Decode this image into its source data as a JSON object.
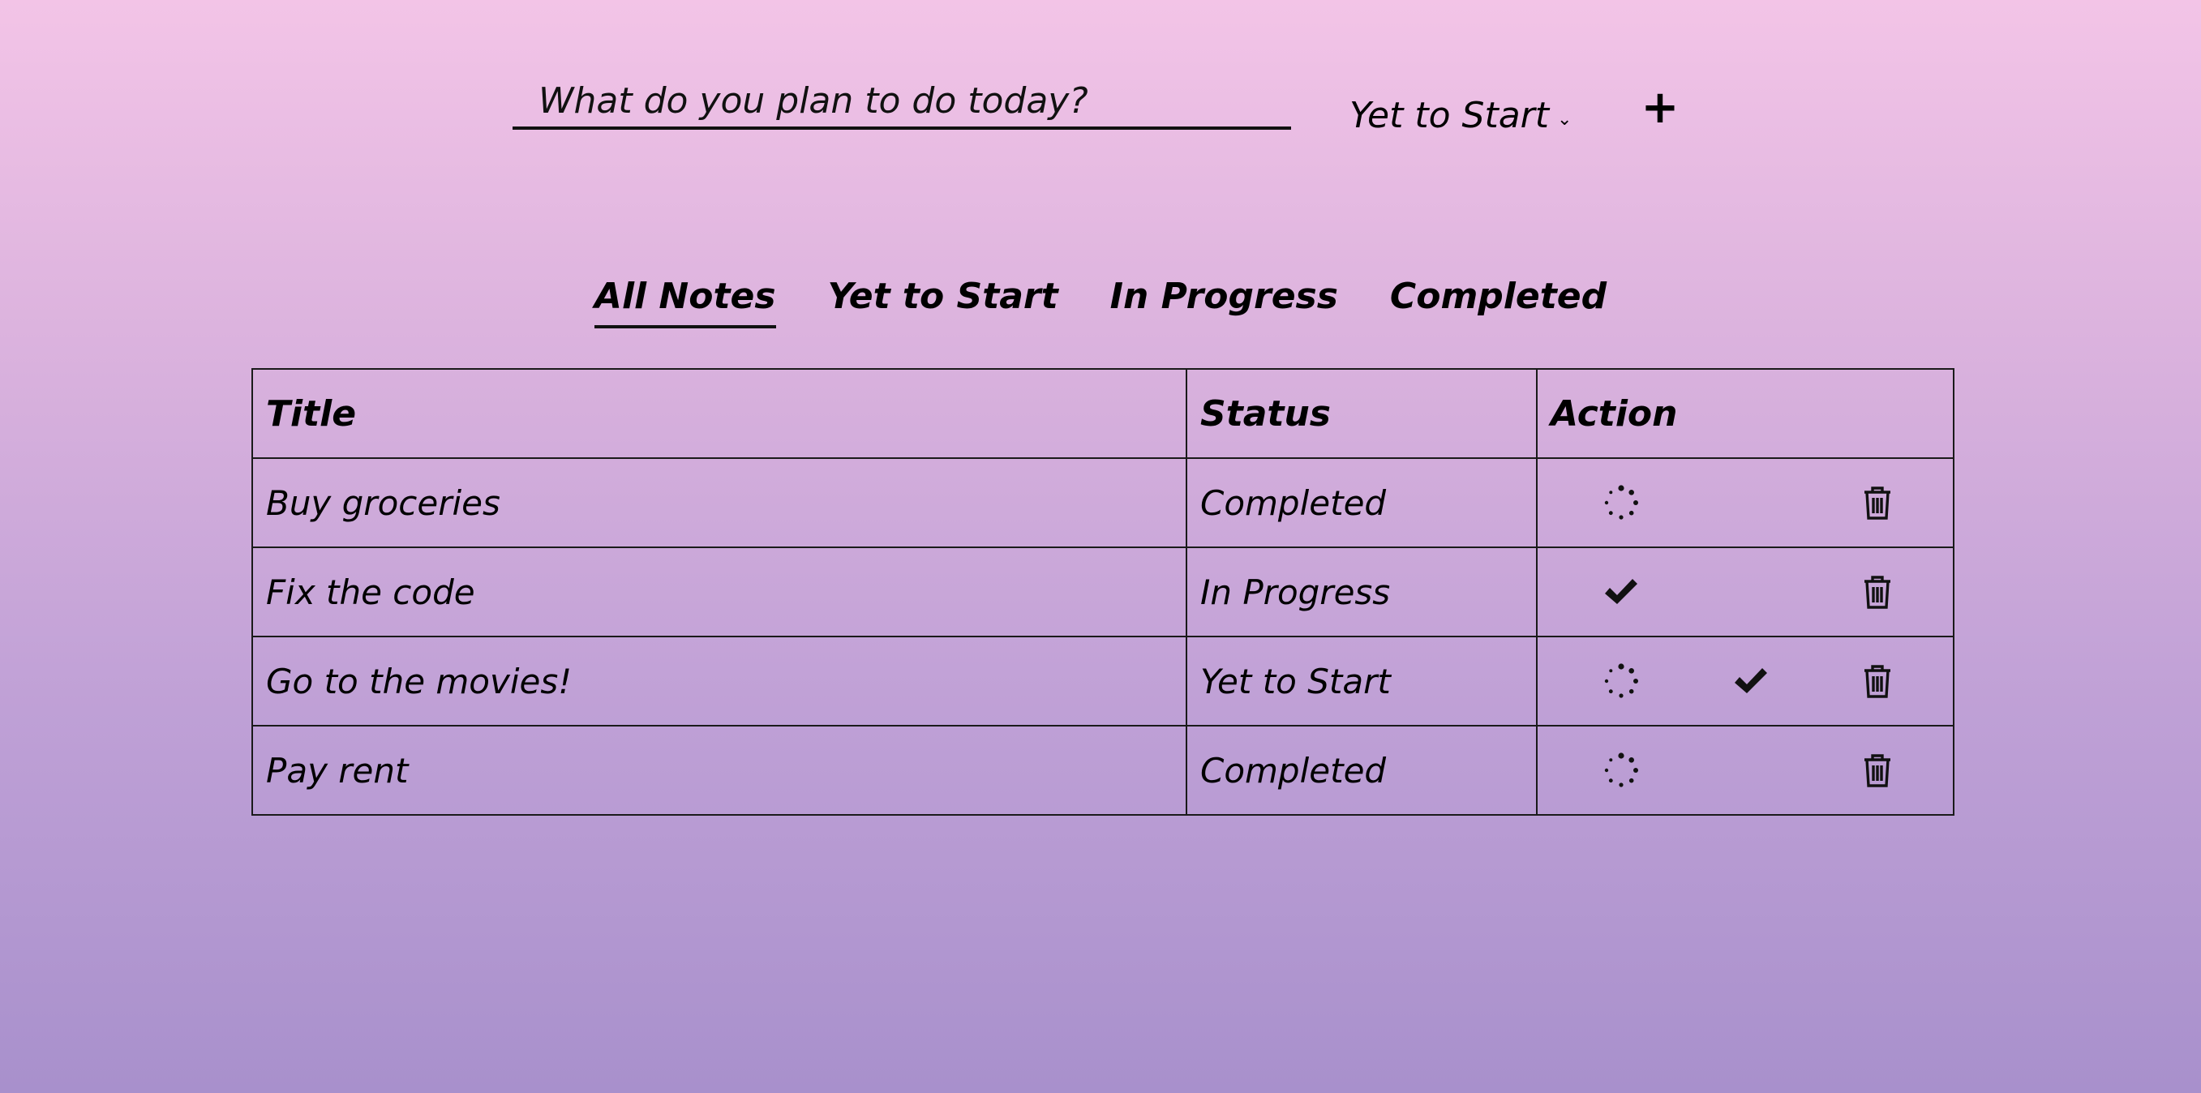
{
  "entry": {
    "placeholder": "What do you plan to do today?",
    "status_value": "Yet to Start",
    "add_label": "+"
  },
  "tabs": [
    {
      "label": "All Notes",
      "active": true
    },
    {
      "label": "Yet to Start",
      "active": false
    },
    {
      "label": "In Progress",
      "active": false
    },
    {
      "label": "Completed",
      "active": false
    }
  ],
  "table": {
    "headers": {
      "title": "Title",
      "status": "Status",
      "action": "Action"
    },
    "rows": [
      {
        "title": "Buy groceries",
        "status": "Completed"
      },
      {
        "title": "Fix the code",
        "status": "In Progress"
      },
      {
        "title": "Go to the movies!",
        "status": "Yet to Start"
      },
      {
        "title": "Pay rent",
        "status": "Completed"
      }
    ]
  },
  "icons": {
    "progress": "spinner-icon",
    "complete": "checkmark-icon",
    "delete": "trash-icon"
  }
}
